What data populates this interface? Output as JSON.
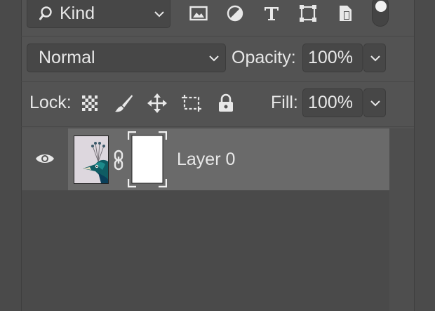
{
  "filter": {
    "kind_label": "Kind"
  },
  "blend": {
    "mode": "Normal",
    "opacity_label": "Opacity:",
    "opacity_value": "100%"
  },
  "lock": {
    "label": "Lock:",
    "fill_label": "Fill:",
    "fill_value": "100%"
  },
  "layers": [
    {
      "name": "Layer 0",
      "visible": true,
      "has_mask": true
    }
  ],
  "icons": {
    "search": "search-icon",
    "image_filter": "image-filter-icon",
    "adjustment_filter": "adjustment-filter-icon",
    "type_filter": "type-filter-icon",
    "shape_filter": "shape-filter-icon",
    "smart_object_filter": "smart-object-filter-icon",
    "eye": "eye-icon",
    "link": "link-icon"
  },
  "colors": {
    "panel": "#535353",
    "selected_row": "#6a6a6a",
    "text": "#e8e8e8"
  }
}
